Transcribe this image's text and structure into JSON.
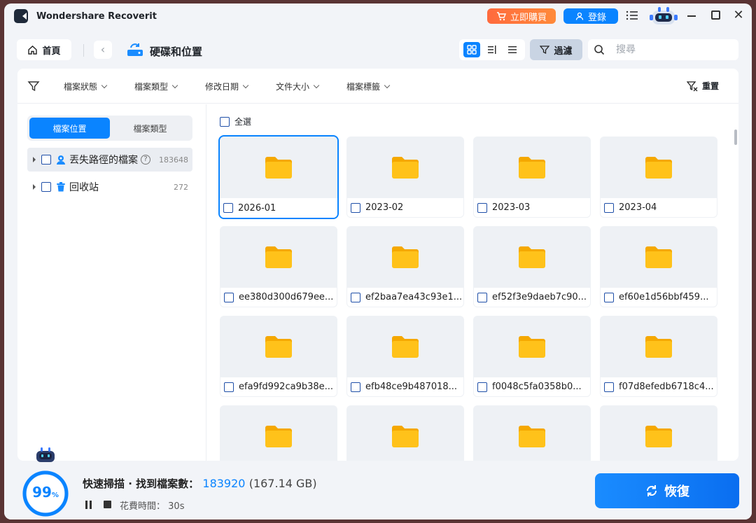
{
  "app": {
    "title": "Wondershare Recoverit"
  },
  "titlebar": {
    "buy_label": "立即購買",
    "login_label": "登錄"
  },
  "nav": {
    "home_label": "首頁",
    "location_title": "硬碟和位置",
    "filter_label": "過濾",
    "search_placeholder": "搜尋"
  },
  "filters": {
    "status": "檔案狀態",
    "type": "檔案類型",
    "modified": "修改日期",
    "size": "文件大小",
    "tags": "檔案標籤",
    "reset": "重置"
  },
  "sidebar": {
    "tabs": [
      {
        "label": "檔案位置",
        "active": true
      },
      {
        "label": "檔案類型",
        "active": false
      }
    ],
    "items": [
      {
        "label": "丟失路徑的檔案",
        "count": "183648",
        "icon": "lost-path-icon"
      },
      {
        "label": "回收站",
        "count": "272",
        "icon": "recycle-bin-icon"
      }
    ]
  },
  "grid": {
    "select_all": "全選",
    "folders": [
      {
        "name": "2026-01",
        "selected": true
      },
      {
        "name": "2023-02"
      },
      {
        "name": "2023-03"
      },
      {
        "name": "2023-04"
      },
      {
        "name": "ee380d300d679ee..."
      },
      {
        "name": "ef2baa7ea43c93e1..."
      },
      {
        "name": "ef52f3e9daeb7c90..."
      },
      {
        "name": "ef60e1d56bbf459..."
      },
      {
        "name": "efa9fd992ca9b38e..."
      },
      {
        "name": "efb48ce9b487018..."
      },
      {
        "name": "f0048c5fa0358b0..."
      },
      {
        "name": "f07d8efedb6718c4..."
      },
      {
        "name": ""
      },
      {
        "name": ""
      },
      {
        "name": ""
      },
      {
        "name": ""
      }
    ]
  },
  "footer": {
    "progress": "99",
    "progress_unit": "%",
    "progress_fraction": 0.99,
    "scan_label": "快速掃描 · 找到檔案數：",
    "file_count": "183920",
    "total_size": "(167.14 GB)",
    "time_label": "花費時間：",
    "time_value": "30s",
    "recover_label": "恢復"
  },
  "colors": {
    "accent": "#0a84ff",
    "folder": "#ffc21a",
    "buy": "#ff6a3d"
  }
}
